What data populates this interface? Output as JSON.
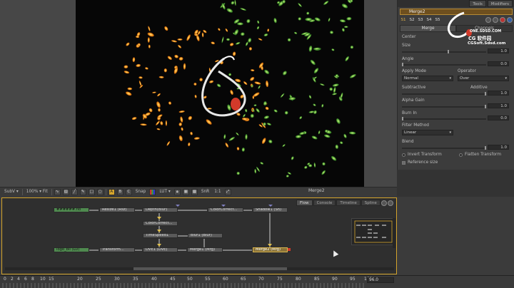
{
  "viewer": {
    "toolbar": {
      "subv": "SubV ▾",
      "zoom": "100% ▾ Fit",
      "abc": [
        "A",
        "B",
        "C"
      ],
      "snap": "Snap",
      "lut": "LUT ▾",
      "snr": "SnR",
      "ratio": "1:1"
    },
    "title": "Merge2"
  },
  "inspector": {
    "top_tabs": [
      "Tools",
      "Modifiers"
    ],
    "tool_name": "Merge2",
    "numbers": [
      "S1",
      "S2",
      "S3",
      "S4",
      "S5"
    ],
    "sub_tabs": [
      "Merge",
      "Channels"
    ],
    "params": {
      "center_label": "Center",
      "size_label": "Size",
      "size_val": "1.0",
      "angle_label": "Angle",
      "angle_val": "0.0",
      "apply_mode_label": "Apply Mode",
      "apply_mode_val": "Normal",
      "operator_label": "Operator",
      "operator_val": "Over",
      "subtractive_label": "Subtractive",
      "additive_label": "Additive",
      "subadd_val": "1.0",
      "alpha_gain_label": "Alpha Gain",
      "alpha_gain_val": "1.0",
      "burn_in_label": "Burn In",
      "burn_in_val": "0.0",
      "filter_label": "Filter Method",
      "filter_val": "Linear",
      "blend_label": "Blend",
      "blend_val": "1.0",
      "invert_label": "Invert Transform",
      "flatten_label": "Flatten Transform",
      "reference_label": "Reference size"
    }
  },
  "watermark": {
    "line1": "ONE.SDSD.COM",
    "line2": "CG 软件园",
    "line3": "CGSoft.Sdsd.com"
  },
  "flow": {
    "tabs": [
      "Flow",
      "Console",
      "Timeline",
      "Spline"
    ],
    "nodes": {
      "loader1": "######.flo",
      "resize": "Resize1 (Rsz)",
      "depth": "Depth(Blur)",
      "colorcorrect1": "ColorCorrect...",
      "shadow": "Shadow1 (Sh)",
      "colorcorrect2": "ColorCorrect...",
      "timespeed": "TimeSpeed1",
      "blur": "Blur1 (Blur)",
      "loader2": "logo_bll (LD)",
      "transform": "Transform...",
      "dve": "DVE1 (DVE)",
      "merge1": "Merge1 (Mrg)",
      "merge2": "Merge2 (Mrg)"
    }
  },
  "timeline": {
    "ticks": [
      "0",
      "2",
      "4",
      "6",
      "8",
      "10",
      "15",
      "20",
      "25",
      "30",
      "35",
      "40",
      "45",
      "50",
      "55",
      "60",
      "65",
      "70",
      "75",
      "80",
      "85",
      "90",
      "95",
      "100"
    ],
    "current": "96.0"
  },
  "colors": {
    "accent": "#d4a42c",
    "merge_red": "#d23a2a"
  }
}
